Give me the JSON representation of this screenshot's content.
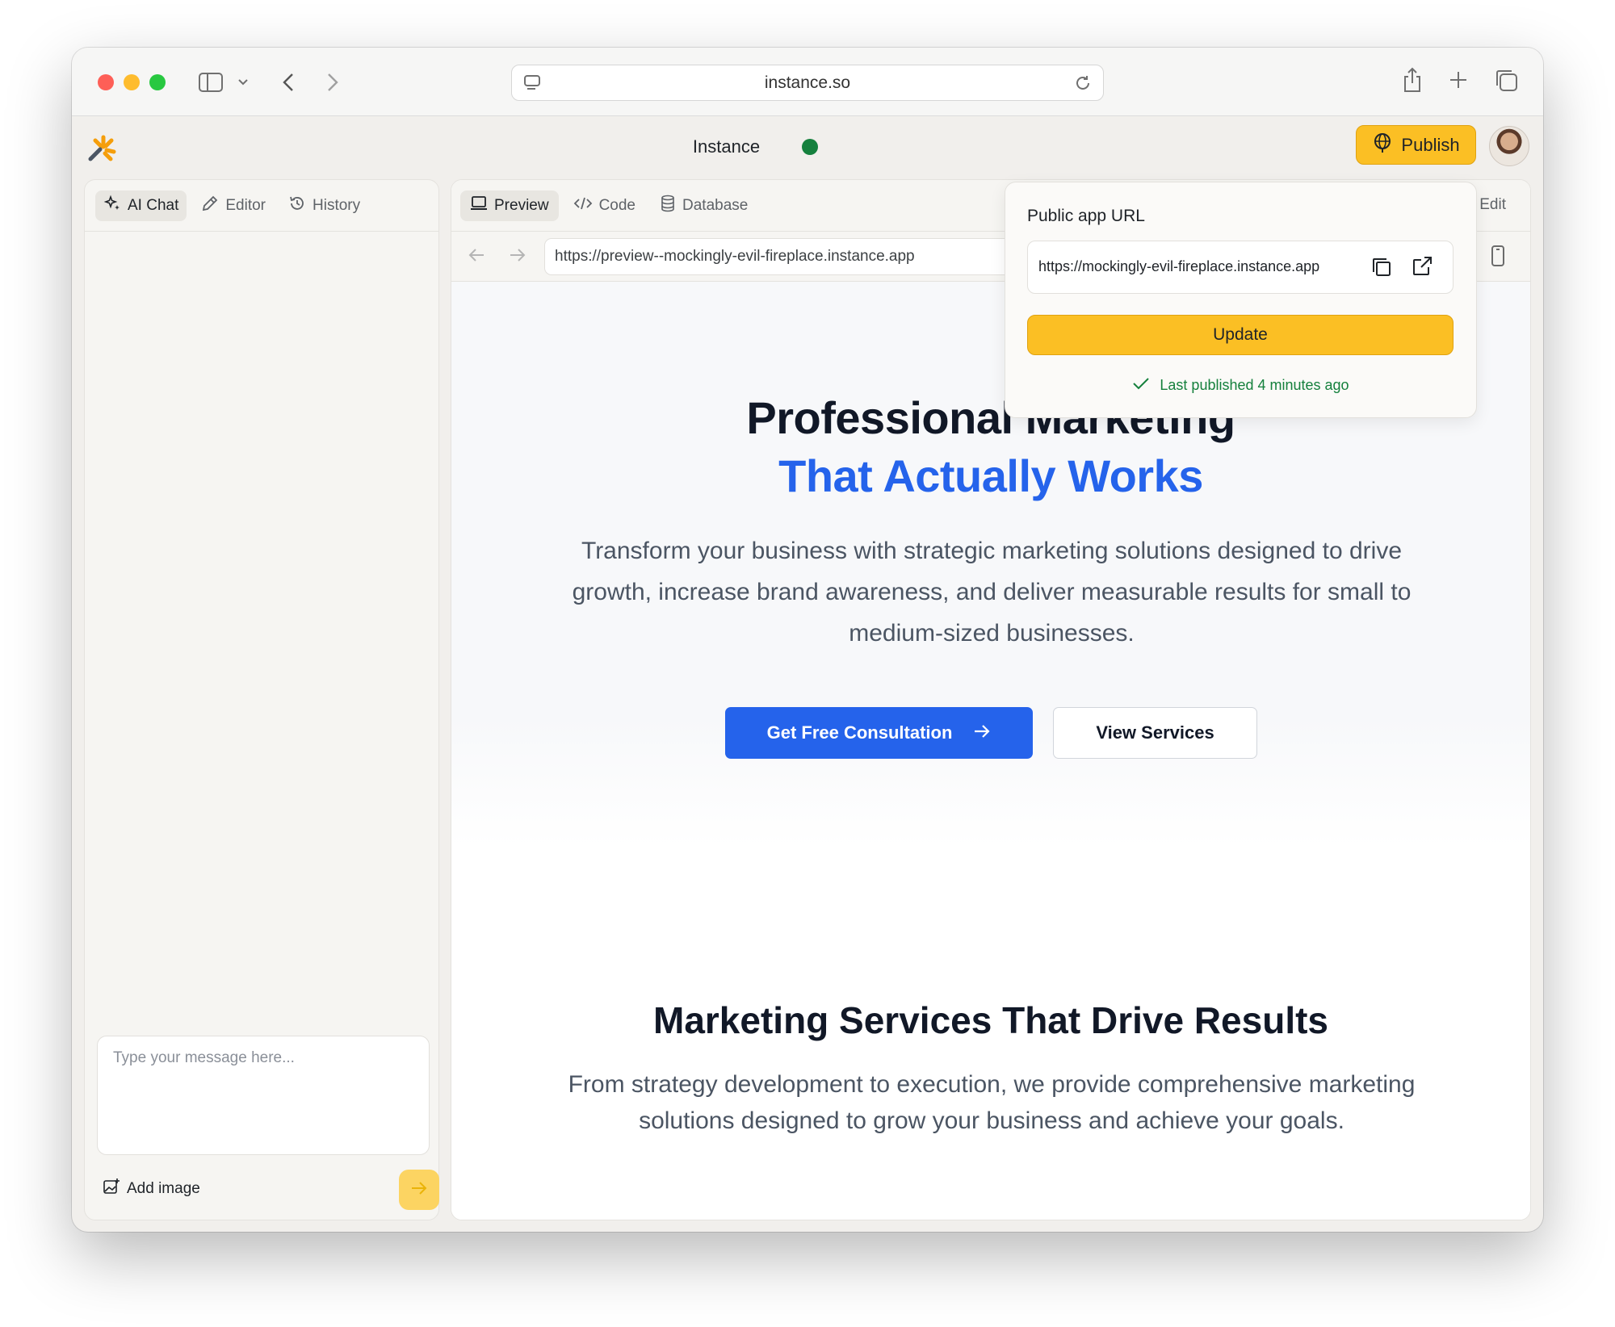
{
  "browser": {
    "address": "instance.so"
  },
  "app": {
    "title": "Instance",
    "publish_label": "Publish",
    "status_color": "#15803d",
    "accent": "#fbbf24"
  },
  "left_panel": {
    "tabs": [
      {
        "label": "AI Chat",
        "icon": "sparkle-icon",
        "active": true
      },
      {
        "label": "Editor",
        "icon": "pencil-icon",
        "active": false
      },
      {
        "label": "History",
        "icon": "history-icon",
        "active": false
      }
    ],
    "message_placeholder": "Type your message here...",
    "add_image_label": "Add image"
  },
  "right_panel": {
    "tabs": [
      {
        "label": "Preview",
        "icon": "laptop-icon",
        "active": true
      },
      {
        "label": "Code",
        "icon": "code-icon",
        "active": false
      },
      {
        "label": "Database",
        "icon": "database-icon",
        "active": false
      }
    ],
    "edit_label": "Edit",
    "preview_url": "https://preview--mockingly-evil-fireplace.instance.app"
  },
  "site": {
    "hero_title_line1": "Professional Marketing",
    "hero_title_line2": "That Actually Works",
    "hero_text": "Transform your business with strategic marketing solutions designed to drive growth, increase brand awareness, and deliver measurable results for small to medium-sized businesses.",
    "cta_primary": "Get Free Consultation",
    "cta_secondary": "View Services",
    "section_title": "Marketing Services That Drive Results",
    "section_text": "From strategy development to execution, we provide comprehensive marketing solutions designed to grow your business and achieve your goals.",
    "primary_color": "#2563eb"
  },
  "popover": {
    "title": "Public app URL",
    "url": "https://mockingly-evil-fireplace.instance.app",
    "update_label": "Update",
    "status": "Last published 4 minutes ago"
  }
}
